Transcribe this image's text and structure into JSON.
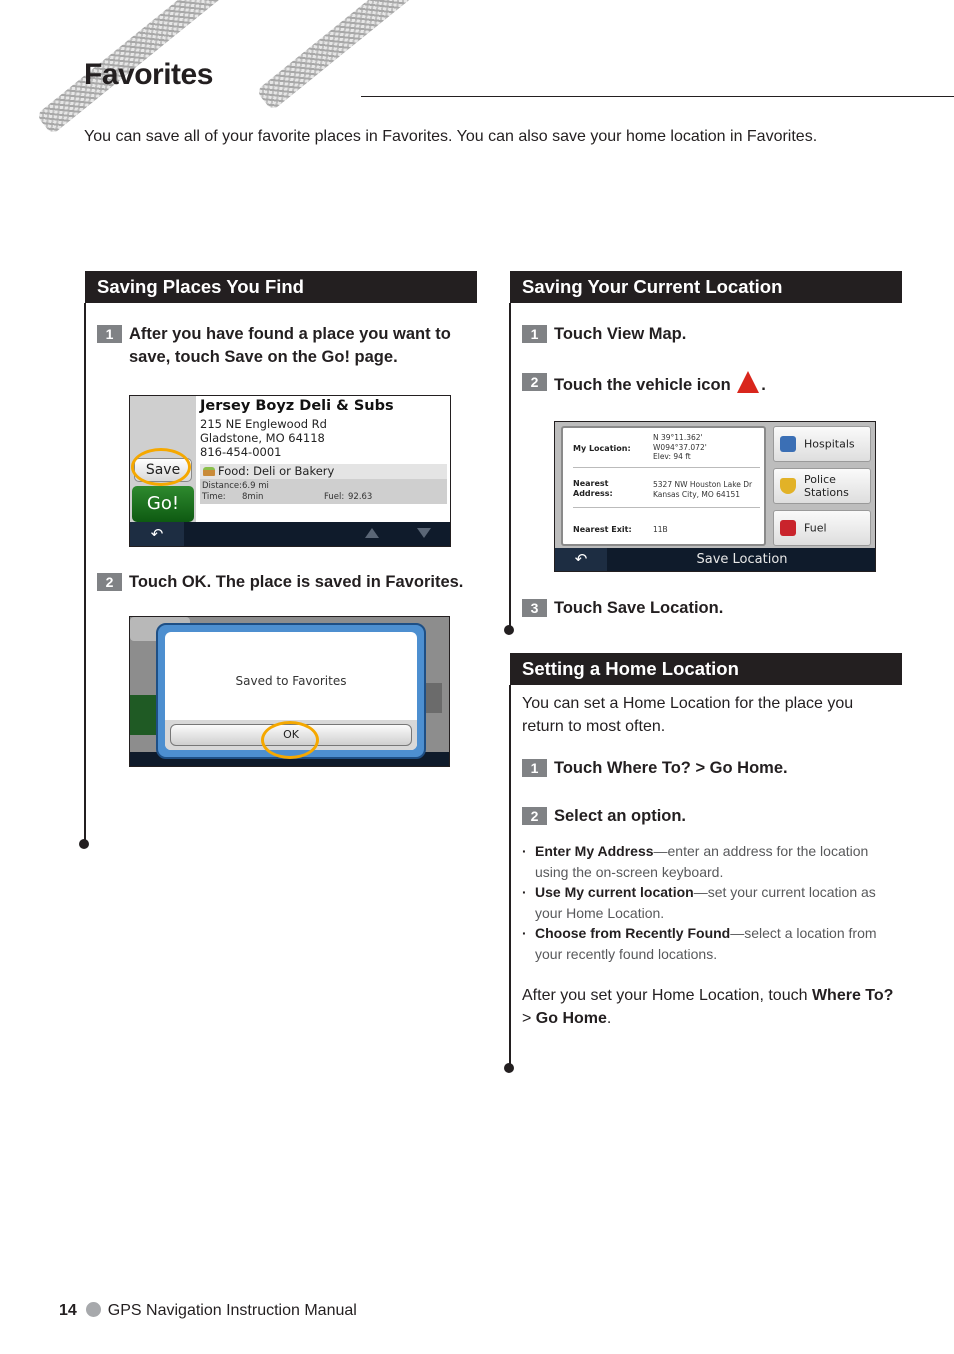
{
  "page": {
    "title": "Favorites",
    "intro": "You can save all of your favorite places in Favorites. You can also save your home location in Favorites."
  },
  "sections": {
    "saving_places": {
      "heading": "Saving Places You Find",
      "steps": [
        {
          "num": "1",
          "text": "After you have found a place you want to save, touch Save on the Go! page."
        },
        {
          "num": "2",
          "text": "Touch OK. The place is saved in Favorites."
        }
      ],
      "screen_go_page": {
        "place_name": "Jersey Boyz Deli & Subs",
        "address_line1": "215 NE Englewood Rd",
        "address_line2": "Gladstone, MO 64118",
        "phone": "816-454-0001",
        "category": "Food: Deli or Bakery",
        "distance_label": "Distance:",
        "distance_value": "6.9 mi",
        "time_label": "Time:",
        "time_value": "8min",
        "fuel_label": "Fuel:",
        "fuel_value": "92.63",
        "save_button": "Save",
        "go_button": "Go!",
        "back_icon": "back-arrow-icon",
        "highlight_color": "#f5a800"
      },
      "screen_saved_dialog": {
        "message": "Saved to Favorites",
        "ok_button": "OK",
        "highlight_color": "#f5a800"
      }
    },
    "saving_current_location": {
      "heading": "Saving Your Current Location",
      "steps": [
        {
          "num": "1",
          "text": "Touch View Map."
        },
        {
          "num": "2",
          "text_before": "Touch the vehicle icon",
          "text_after": "."
        },
        {
          "num": "3",
          "text": "Touch Save Location."
        }
      ],
      "screen_where_am_i": {
        "my_location_label": "My Location:",
        "latitude": "N 39°11.362'",
        "longitude": "W094°37.072'",
        "elevation": "Elev: 94 ft",
        "nearest_address_label1": "Nearest",
        "nearest_address_label2": "Address:",
        "nearest_address_line1": "5327 NW Houston Lake Dr",
        "nearest_address_line2": "Kansas City, MO 64151",
        "nearest_exit_label": "Nearest Exit:",
        "nearest_exit_value": "11B",
        "buttons": [
          {
            "label": "Hospitals",
            "icon": "hospital-icon"
          },
          {
            "label": "Police Stations",
            "icon": "police-badge-icon"
          },
          {
            "label": "Fuel",
            "icon": "fuel-pump-icon"
          }
        ],
        "save_location_button": "Save Location"
      }
    },
    "home_location": {
      "heading": "Setting a Home Location",
      "intro": "You can set a Home Location for the place you return to most often.",
      "steps": [
        {
          "num": "1",
          "text": "Touch Where To? > Go Home."
        },
        {
          "num": "2",
          "text": "Select an option."
        }
      ],
      "options": [
        {
          "bold": "Enter My Address",
          "rest": "—enter an address for the location using the on-screen keyboard."
        },
        {
          "bold": "Use My current location",
          "rest": "—set your current location as your Home Location."
        },
        {
          "bold": "Choose from Recently Found",
          "rest": "—select a location from your recently found locations."
        }
      ],
      "outro": {
        "part1": "After you set your Home Location, touch ",
        "bold1": "Where To?",
        "part2": " > ",
        "bold2": "Go Home",
        "part3": "."
      }
    }
  },
  "footer": {
    "page_number": "14",
    "manual_title": "GPS Navigation Instruction Manual"
  }
}
